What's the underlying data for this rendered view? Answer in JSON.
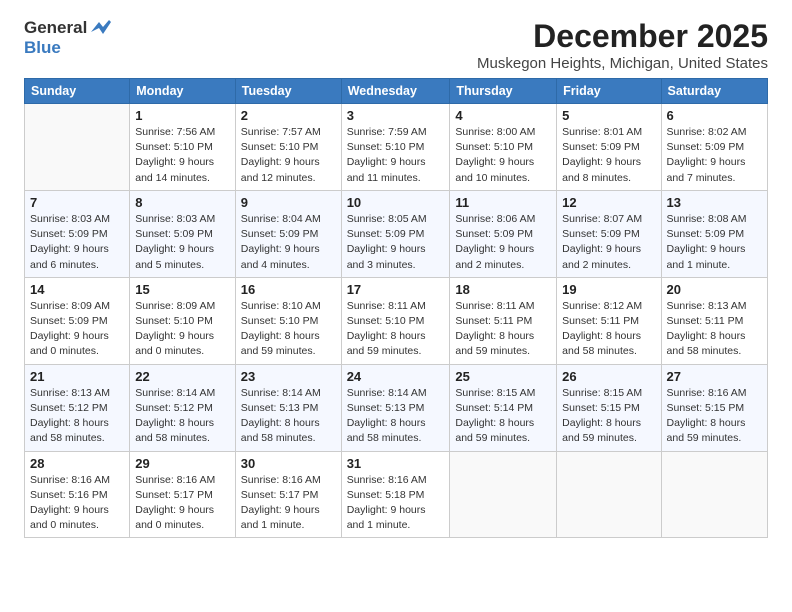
{
  "logo": {
    "general": "General",
    "blue": "Blue",
    "bird_symbol": "▶"
  },
  "title": "December 2025",
  "location": "Muskegon Heights, Michigan, United States",
  "days_of_week": [
    "Sunday",
    "Monday",
    "Tuesday",
    "Wednesday",
    "Thursday",
    "Friday",
    "Saturday"
  ],
  "weeks": [
    [
      {
        "day": "",
        "sunrise": "",
        "sunset": "",
        "daylight": ""
      },
      {
        "day": "1",
        "sunrise": "Sunrise: 7:56 AM",
        "sunset": "Sunset: 5:10 PM",
        "daylight": "Daylight: 9 hours and 14 minutes."
      },
      {
        "day": "2",
        "sunrise": "Sunrise: 7:57 AM",
        "sunset": "Sunset: 5:10 PM",
        "daylight": "Daylight: 9 hours and 12 minutes."
      },
      {
        "day": "3",
        "sunrise": "Sunrise: 7:59 AM",
        "sunset": "Sunset: 5:10 PM",
        "daylight": "Daylight: 9 hours and 11 minutes."
      },
      {
        "day": "4",
        "sunrise": "Sunrise: 8:00 AM",
        "sunset": "Sunset: 5:10 PM",
        "daylight": "Daylight: 9 hours and 10 minutes."
      },
      {
        "day": "5",
        "sunrise": "Sunrise: 8:01 AM",
        "sunset": "Sunset: 5:09 PM",
        "daylight": "Daylight: 9 hours and 8 minutes."
      },
      {
        "day": "6",
        "sunrise": "Sunrise: 8:02 AM",
        "sunset": "Sunset: 5:09 PM",
        "daylight": "Daylight: 9 hours and 7 minutes."
      }
    ],
    [
      {
        "day": "7",
        "sunrise": "Sunrise: 8:03 AM",
        "sunset": "Sunset: 5:09 PM",
        "daylight": "Daylight: 9 hours and 6 minutes."
      },
      {
        "day": "8",
        "sunrise": "Sunrise: 8:03 AM",
        "sunset": "Sunset: 5:09 PM",
        "daylight": "Daylight: 9 hours and 5 minutes."
      },
      {
        "day": "9",
        "sunrise": "Sunrise: 8:04 AM",
        "sunset": "Sunset: 5:09 PM",
        "daylight": "Daylight: 9 hours and 4 minutes."
      },
      {
        "day": "10",
        "sunrise": "Sunrise: 8:05 AM",
        "sunset": "Sunset: 5:09 PM",
        "daylight": "Daylight: 9 hours and 3 minutes."
      },
      {
        "day": "11",
        "sunrise": "Sunrise: 8:06 AM",
        "sunset": "Sunset: 5:09 PM",
        "daylight": "Daylight: 9 hours and 2 minutes."
      },
      {
        "day": "12",
        "sunrise": "Sunrise: 8:07 AM",
        "sunset": "Sunset: 5:09 PM",
        "daylight": "Daylight: 9 hours and 2 minutes."
      },
      {
        "day": "13",
        "sunrise": "Sunrise: 8:08 AM",
        "sunset": "Sunset: 5:09 PM",
        "daylight": "Daylight: 9 hours and 1 minute."
      }
    ],
    [
      {
        "day": "14",
        "sunrise": "Sunrise: 8:09 AM",
        "sunset": "Sunset: 5:09 PM",
        "daylight": "Daylight: 9 hours and 0 minutes."
      },
      {
        "day": "15",
        "sunrise": "Sunrise: 8:09 AM",
        "sunset": "Sunset: 5:10 PM",
        "daylight": "Daylight: 9 hours and 0 minutes."
      },
      {
        "day": "16",
        "sunrise": "Sunrise: 8:10 AM",
        "sunset": "Sunset: 5:10 PM",
        "daylight": "Daylight: 8 hours and 59 minutes."
      },
      {
        "day": "17",
        "sunrise": "Sunrise: 8:11 AM",
        "sunset": "Sunset: 5:10 PM",
        "daylight": "Daylight: 8 hours and 59 minutes."
      },
      {
        "day": "18",
        "sunrise": "Sunrise: 8:11 AM",
        "sunset": "Sunset: 5:11 PM",
        "daylight": "Daylight: 8 hours and 59 minutes."
      },
      {
        "day": "19",
        "sunrise": "Sunrise: 8:12 AM",
        "sunset": "Sunset: 5:11 PM",
        "daylight": "Daylight: 8 hours and 58 minutes."
      },
      {
        "day": "20",
        "sunrise": "Sunrise: 8:13 AM",
        "sunset": "Sunset: 5:11 PM",
        "daylight": "Daylight: 8 hours and 58 minutes."
      }
    ],
    [
      {
        "day": "21",
        "sunrise": "Sunrise: 8:13 AM",
        "sunset": "Sunset: 5:12 PM",
        "daylight": "Daylight: 8 hours and 58 minutes."
      },
      {
        "day": "22",
        "sunrise": "Sunrise: 8:14 AM",
        "sunset": "Sunset: 5:12 PM",
        "daylight": "Daylight: 8 hours and 58 minutes."
      },
      {
        "day": "23",
        "sunrise": "Sunrise: 8:14 AM",
        "sunset": "Sunset: 5:13 PM",
        "daylight": "Daylight: 8 hours and 58 minutes."
      },
      {
        "day": "24",
        "sunrise": "Sunrise: 8:14 AM",
        "sunset": "Sunset: 5:13 PM",
        "daylight": "Daylight: 8 hours and 58 minutes."
      },
      {
        "day": "25",
        "sunrise": "Sunrise: 8:15 AM",
        "sunset": "Sunset: 5:14 PM",
        "daylight": "Daylight: 8 hours and 59 minutes."
      },
      {
        "day": "26",
        "sunrise": "Sunrise: 8:15 AM",
        "sunset": "Sunset: 5:15 PM",
        "daylight": "Daylight: 8 hours and 59 minutes."
      },
      {
        "day": "27",
        "sunrise": "Sunrise: 8:16 AM",
        "sunset": "Sunset: 5:15 PM",
        "daylight": "Daylight: 8 hours and 59 minutes."
      }
    ],
    [
      {
        "day": "28",
        "sunrise": "Sunrise: 8:16 AM",
        "sunset": "Sunset: 5:16 PM",
        "daylight": "Daylight: 9 hours and 0 minutes."
      },
      {
        "day": "29",
        "sunrise": "Sunrise: 8:16 AM",
        "sunset": "Sunset: 5:17 PM",
        "daylight": "Daylight: 9 hours and 0 minutes."
      },
      {
        "day": "30",
        "sunrise": "Sunrise: 8:16 AM",
        "sunset": "Sunset: 5:17 PM",
        "daylight": "Daylight: 9 hours and 1 minute."
      },
      {
        "day": "31",
        "sunrise": "Sunrise: 8:16 AM",
        "sunset": "Sunset: 5:18 PM",
        "daylight": "Daylight: 9 hours and 1 minute."
      },
      {
        "day": "",
        "sunrise": "",
        "sunset": "",
        "daylight": ""
      },
      {
        "day": "",
        "sunrise": "",
        "sunset": "",
        "daylight": ""
      },
      {
        "day": "",
        "sunrise": "",
        "sunset": "",
        "daylight": ""
      }
    ]
  ]
}
